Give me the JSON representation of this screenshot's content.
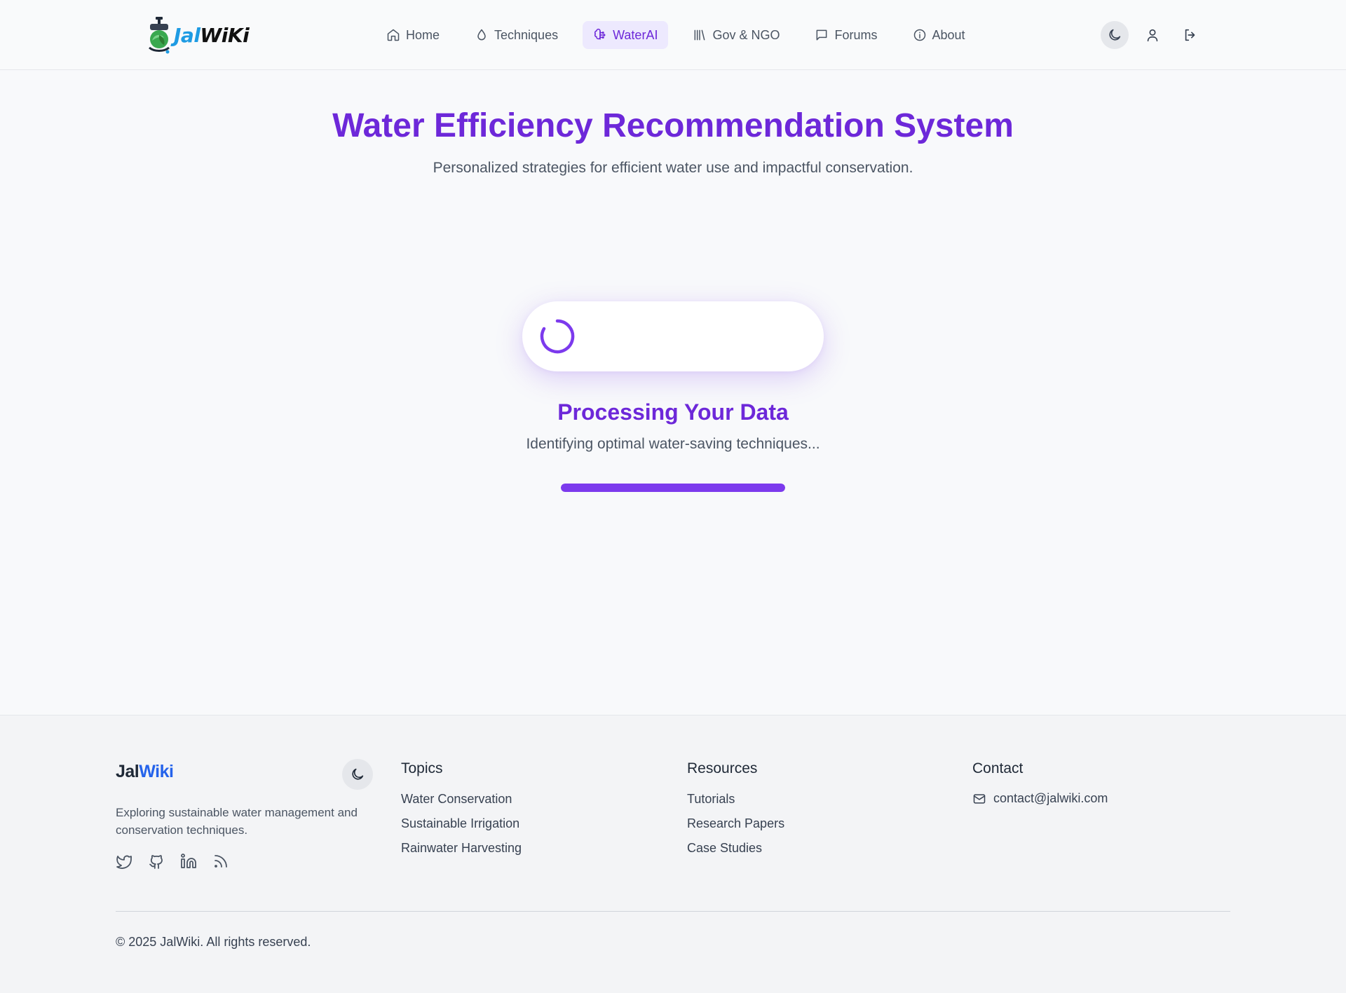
{
  "brand": {
    "logo_part1": "Jal",
    "logo_part2": "WiKi"
  },
  "nav": {
    "items": [
      {
        "label": "Home",
        "icon": "home-icon"
      },
      {
        "label": "Techniques",
        "icon": "droplet-icon"
      },
      {
        "label": "WaterAI",
        "icon": "brain-icon",
        "active": true
      },
      {
        "label": "Gov & NGO",
        "icon": "library-icon"
      },
      {
        "label": "Forums",
        "icon": "message-square-icon"
      },
      {
        "label": "About",
        "icon": "info-icon"
      }
    ]
  },
  "header_actions": [
    "moon-icon",
    "user-icon",
    "logout-icon"
  ],
  "main": {
    "title": "Water Efficiency Recommendation System",
    "subtitle": "Personalized strategies for efficient water use and impactful conservation.",
    "processing_title": "Processing Your Data",
    "processing_text": "Identifying optimal water-saving techniques...",
    "progress": 1.0
  },
  "footer": {
    "brand_part1": "Jal",
    "brand_part2": "Wiki",
    "description": "Exploring sustainable water management and conservation techniques.",
    "social": [
      "twitter-icon",
      "github-icon",
      "linkedin-icon",
      "rss-icon"
    ],
    "topics": {
      "heading": "Topics",
      "items": [
        "Water Conservation",
        "Sustainable Irrigation",
        "Rainwater Harvesting"
      ]
    },
    "resources": {
      "heading": "Resources",
      "items": [
        "Tutorials",
        "Research Papers",
        "Case Studies"
      ]
    },
    "contact": {
      "heading": "Contact",
      "email": "contact@jalwiki.com"
    },
    "copyright": "© 2025 JalWiki. All rights reserved."
  },
  "colors": {
    "accent": "#6d28d9",
    "accent_light": "#ede9fe",
    "progress": "#7c3aed",
    "brand_blue": "#2563eb",
    "logo_blue": "#1e9be3"
  }
}
